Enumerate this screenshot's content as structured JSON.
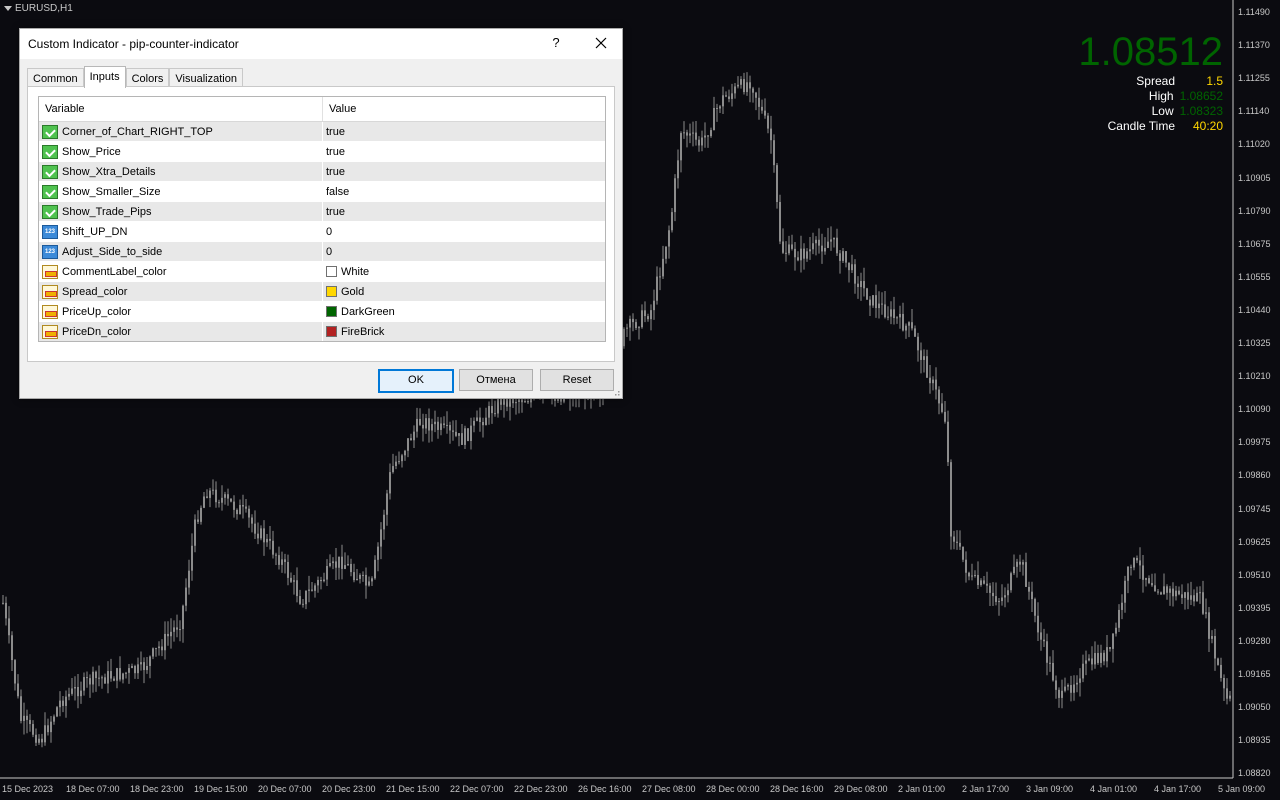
{
  "chart": {
    "symbol": "EURUSD,H1",
    "price_ticks": [
      "1.11490",
      "1.11370",
      "1.11255",
      "1.11140",
      "1.11020",
      "1.10905",
      "1.10790",
      "1.10675",
      "1.10555",
      "1.10440",
      "1.10325",
      "1.10210",
      "1.10090",
      "1.09975",
      "1.09860",
      "1.09745",
      "1.09625",
      "1.09510",
      "1.09395",
      "1.09280",
      "1.09165",
      "1.09050",
      "1.08935",
      "1.08820"
    ],
    "time_ticks": [
      "15 Dec 2023",
      "18 Dec 07:00",
      "18 Dec 23:00",
      "19 Dec 15:00",
      "20 Dec 07:00",
      "20 Dec 23:00",
      "21 Dec 15:00",
      "22 Dec 07:00",
      "22 Dec 23:00",
      "26 Dec 16:00",
      "27 Dec 08:00",
      "28 Dec 00:00",
      "28 Dec 16:00",
      "29 Dec 08:00",
      "2 Jan 01:00",
      "2 Jan 17:00",
      "3 Jan 09:00",
      "4 Jan 01:00",
      "4 Jan 17:00",
      "5 Jan 09:00"
    ],
    "candle_color": "#8c8c8c",
    "background": "#0b0b10"
  },
  "overlay": {
    "price": "1.08512",
    "price_color": "#006400",
    "rows": [
      {
        "label": "Spread",
        "value": "1.5",
        "color": "#ffd700"
      },
      {
        "label": "High",
        "value": "1.08652",
        "color": "#006400"
      },
      {
        "label": "Low",
        "value": "1.08323",
        "color": "#006400"
      },
      {
        "label": "Candle Time",
        "value": "40:20",
        "color": "#ffd700"
      }
    ]
  },
  "dialog": {
    "title": "Custom Indicator - pip-counter-indicator",
    "help": "?",
    "tabs": [
      "Common",
      "Inputs",
      "Colors",
      "Visualization"
    ],
    "active_tab": "Inputs",
    "columns": {
      "variable": "Variable",
      "value": "Value"
    },
    "rows": [
      {
        "name": "Corner_of_Chart_RIGHT_TOP",
        "value": "true",
        "type": "bool-icon"
      },
      {
        "name": "Show_Price",
        "value": "true",
        "type": "bool-icon"
      },
      {
        "name": "Show_Xtra_Details",
        "value": "true",
        "type": "bool-icon"
      },
      {
        "name": "Show_Smaller_Size",
        "value": "false",
        "type": "bool-icon"
      },
      {
        "name": "Show_Trade_Pips",
        "value": "true",
        "type": "bool-icon"
      },
      {
        "name": "Shift_UP_DN",
        "value": "0",
        "type": "int-icon"
      },
      {
        "name": "Adjust_Side_to_side",
        "value": "0",
        "type": "int-icon"
      },
      {
        "name": "CommentLabel_color",
        "value": "White",
        "type": "color-icon",
        "swatch": "#ffffff"
      },
      {
        "name": "Spread_color",
        "value": "Gold",
        "type": "color-icon",
        "swatch": "#ffd700"
      },
      {
        "name": "PriceUp_color",
        "value": "DarkGreen",
        "type": "color-icon",
        "swatch": "#006400"
      },
      {
        "name": "PriceDn_color",
        "value": "FireBrick",
        "type": "color-icon",
        "swatch": "#b22222"
      }
    ],
    "buttons": {
      "ok": "OK",
      "cancel": "Отмена",
      "reset": "Reset"
    }
  }
}
